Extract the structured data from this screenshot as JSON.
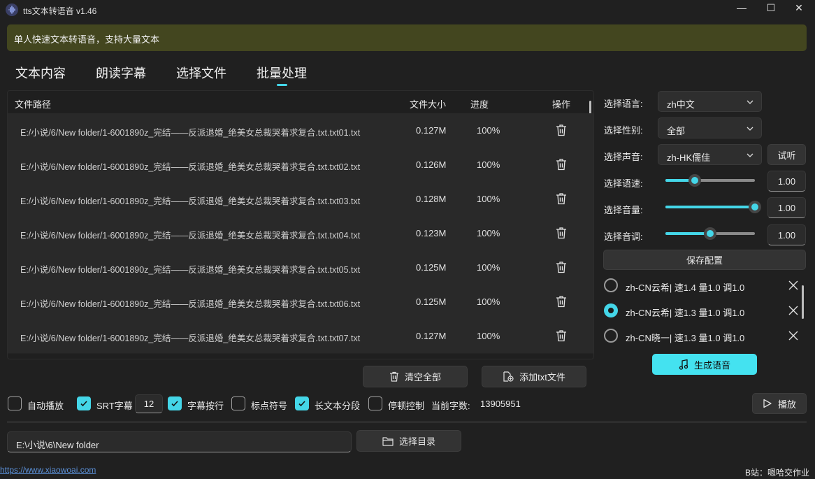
{
  "window": {
    "title": "tts文本转语音 v1.46",
    "minimize_glyph": "—",
    "maximize_glyph": "☐",
    "close_glyph": "✕"
  },
  "info_bar": {
    "text": "单人快速文本转语音，支持大量文本"
  },
  "tabs": [
    {
      "label": "文本内容",
      "active": false
    },
    {
      "label": "朗读字幕",
      "active": false
    },
    {
      "label": "选择文件",
      "active": false
    },
    {
      "label": "批量处理",
      "active": true
    }
  ],
  "table": {
    "headers": {
      "path": "文件路径",
      "size": "文件大小",
      "progress": "进度",
      "action": "操作"
    },
    "rows": [
      {
        "path": "E:/小说/6/New folder/1-6001890z_完结——反派退婚_绝美女总裁哭着求复合.txt.txt01.txt",
        "size": "0.127M",
        "progress": "100%"
      },
      {
        "path": "E:/小说/6/New folder/1-6001890z_完结——反派退婚_绝美女总裁哭着求复合.txt.txt02.txt",
        "size": "0.126M",
        "progress": "100%"
      },
      {
        "path": "E:/小说/6/New folder/1-6001890z_完结——反派退婚_绝美女总裁哭着求复合.txt.txt03.txt",
        "size": "0.128M",
        "progress": "100%"
      },
      {
        "path": "E:/小说/6/New folder/1-6001890z_完结——反派退婚_绝美女总裁哭着求复合.txt.txt04.txt",
        "size": "0.123M",
        "progress": "100%"
      },
      {
        "path": "E:/小说/6/New folder/1-6001890z_完结——反派退婚_绝美女总裁哭着求复合.txt.txt05.txt",
        "size": "0.125M",
        "progress": "100%"
      },
      {
        "path": "E:/小说/6/New folder/1-6001890z_完结——反派退婚_绝美女总裁哭着求复合.txt.txt06.txt",
        "size": "0.125M",
        "progress": "100%"
      },
      {
        "path": "E:/小说/6/New folder/1-6001890z_完结——反派退婚_绝美女总裁哭着求复合.txt.txt07.txt",
        "size": "0.127M",
        "progress": "100%"
      }
    ]
  },
  "table_actions": {
    "clear_all": "清空全部",
    "add_txt": "添加txt文件"
  },
  "settings": {
    "language_label": "选择语言:",
    "language_value": "zh中文",
    "gender_label": "选择性别:",
    "gender_value": "全部",
    "voice_label": "选择声音:",
    "voice_value": "zh-HK儒佳",
    "try_label": "试听",
    "speed_label": "选择语速:",
    "speed_value": "1.00",
    "speed_level": 0.33,
    "volume_label": "选择音量:",
    "volume_value": "1.00",
    "volume_level": 1.0,
    "pitch_label": "选择音调:",
    "pitch_value": "1.00",
    "pitch_level": 0.5,
    "save_label": "保存配置"
  },
  "presets": [
    {
      "text": "zh-CN云希| 速1.4 量1.0 调1.0",
      "selected": false
    },
    {
      "text": "zh-CN云希| 速1.3 量1.0 调1.0",
      "selected": true
    },
    {
      "text": "zh-CN晓一| 速1.3 量1.0 调1.0",
      "selected": false
    }
  ],
  "generate_label": "生成语音",
  "options": {
    "autoplay": {
      "label": "自动播放",
      "checked": false
    },
    "srt": {
      "label": "SRT字幕",
      "checked": true
    },
    "srt_value": "12",
    "wrap": {
      "label": "字幕按行",
      "checked": true
    },
    "punct": {
      "label": "标点符号",
      "checked": false
    },
    "long_split": {
      "label": "长文本分段",
      "checked": true
    },
    "pause": {
      "label": "停顿控制",
      "checked": false
    },
    "char_count_label": "当前字数:",
    "char_count": "13905951"
  },
  "play_label": "播放",
  "output": {
    "path": "E:\\小说\\6\\New folder",
    "choose_dir_label": "选择目录"
  },
  "footer": {
    "link": "https://www.xiaowoai.com",
    "credit": "B站：嗯哈交作业"
  },
  "colors": {
    "accent": "#44d6e8",
    "info_bar": "#43461f",
    "background": "#202020"
  }
}
